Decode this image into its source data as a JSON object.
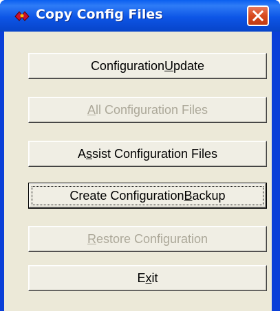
{
  "window": {
    "title": "Copy Config Files",
    "icon": "app-icon",
    "close_icon": "close-icon",
    "titlebar_color": "#0a5ff0",
    "close_color": "#d84a1f",
    "client_color": "#ece9d8"
  },
  "buttons": [
    {
      "pre": "Configuration ",
      "key": "U",
      "post": "pdate",
      "enabled": true,
      "default": false
    },
    {
      "pre": "",
      "key": "A",
      "post": "ll Configuration Files",
      "enabled": false,
      "default": false
    },
    {
      "pre": "A",
      "key": "s",
      "post": "sist Configuration Files",
      "enabled": true,
      "default": false
    },
    {
      "pre": "Create Configuration ",
      "key": "B",
      "post": "ackup",
      "enabled": true,
      "default": true
    },
    {
      "pre": "",
      "key": "R",
      "post": "estore Configuration",
      "enabled": false,
      "default": false
    },
    {
      "pre": "E",
      "key": "x",
      "post": "it",
      "enabled": true,
      "default": false
    }
  ]
}
